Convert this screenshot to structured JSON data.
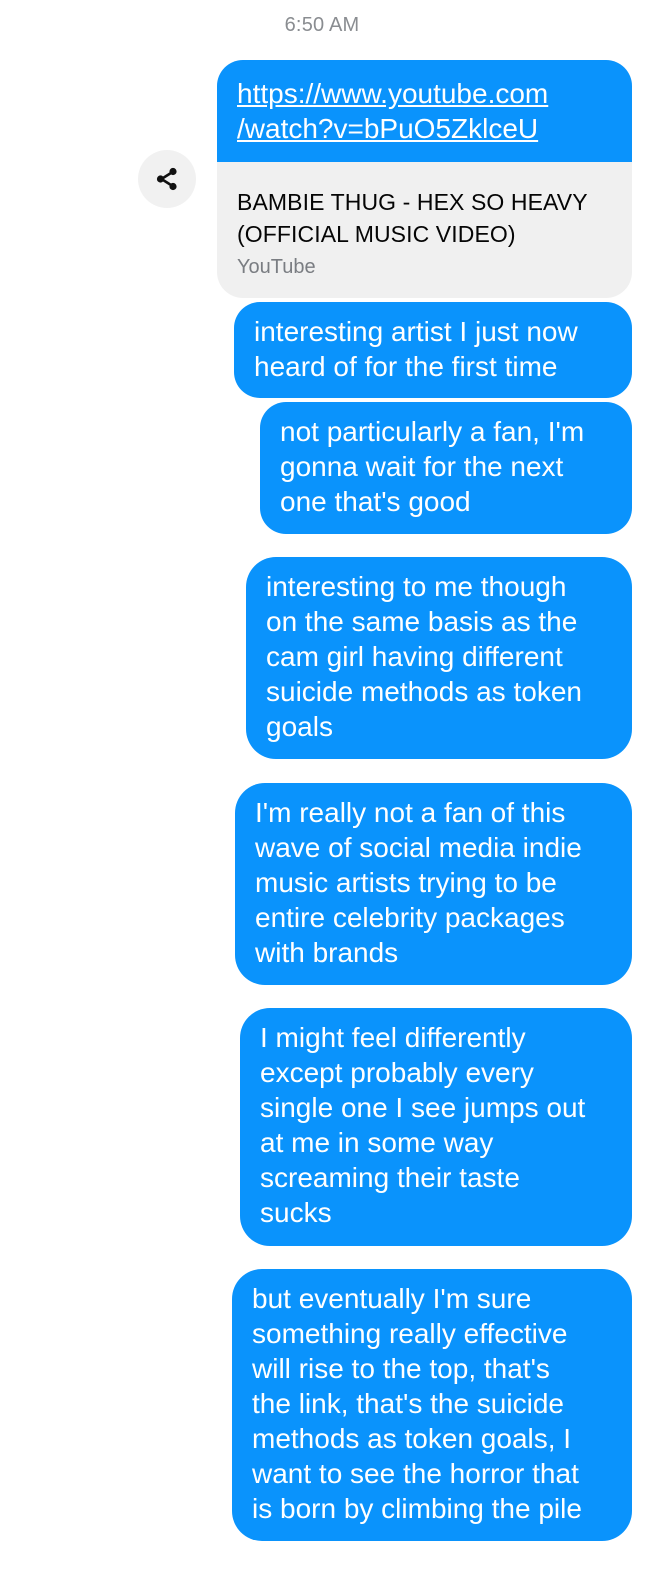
{
  "thread": {
    "timestamp": "6:50 AM",
    "link_message": {
      "url_lines": [
        "https://www.youtube.com",
        "/watch?v=bPuO5ZklceU"
      ],
      "preview_title_lines": [
        "BAMBIE THUG - HEX SO HEAVY",
        "(OFFICIAL MUSIC VIDEO)"
      ],
      "preview_source": "YouTube",
      "share_icon": "share-icon"
    },
    "messages": [
      {
        "lines": [
          "interesting artist I just now",
          "heard of for the first time"
        ]
      },
      {
        "lines": [
          "not particularly a fan, I'm",
          "gonna wait for the next",
          "one that's good"
        ]
      },
      {
        "lines": [
          "interesting to me though",
          "on the same basis as the",
          "cam girl having different",
          "suicide methods as token",
          "goals"
        ]
      },
      {
        "lines": [
          "I'm really not a fan of this",
          "wave of social media indie",
          "music artists trying to be",
          "entire celebrity packages",
          "with brands"
        ]
      },
      {
        "lines": [
          "I might feel differently",
          "except probably every",
          "single one I see jumps out",
          "at me in some way",
          "screaming their taste",
          "sucks"
        ]
      },
      {
        "lines": [
          "but eventually I'm sure",
          "something really effective",
          "will rise to the top, that's",
          "the link, that's the suicide",
          "methods as token goals, I",
          "want to see the horror that",
          "is born by climbing the pile"
        ]
      }
    ],
    "colors": {
      "bubble": "#0a93fc",
      "preview_bg": "#f0f0f0",
      "timestamp": "#8a8d91"
    }
  }
}
